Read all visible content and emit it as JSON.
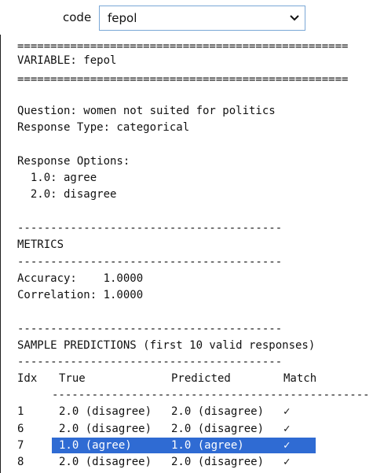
{
  "selector": {
    "label": "code",
    "value": "fepol"
  },
  "output": {
    "eq1": "==================================================",
    "variable": "VARIABLE: fepol",
    "eq2": "==================================================",
    "question": "Question: women not suited for politics",
    "response_type": "Response Type: categorical",
    "response_options_header": "Response Options:",
    "options": [
      "  1.0: agree",
      "  2.0: disagree"
    ],
    "dash1": "----------------------------------------",
    "metrics_header": "METRICS",
    "dash2": "----------------------------------------",
    "accuracy": "Accuracy:    1.0000",
    "correlation": "Correlation: 1.0000",
    "dash3": "----------------------------------------",
    "sample_header": "SAMPLE PREDICTIONS (first 10 valid responses)",
    "dash4": "----------------------------------------",
    "table": {
      "headers": [
        "Idx",
        "True",
        "Predicted",
        "Match"
      ],
      "rule": "------------------------------------------------",
      "rows": [
        {
          "idx": "1",
          "true": "2.0 (disagree)",
          "pred": "2.0 (disagree)",
          "match": "✓"
        },
        {
          "idx": "6",
          "true": "2.0 (disagree)",
          "pred": "2.0 (disagree)",
          "match": "✓"
        },
        {
          "idx": "7",
          "true": "1.0 (agree)",
          "pred": "1.0 (agree)",
          "match": "✓"
        },
        {
          "idx": "8",
          "true": "2.0 (disagree)",
          "pred": "2.0 (disagree)",
          "match": "✓"
        }
      ]
    }
  },
  "colors": {
    "select_border": "#7aa7d6",
    "selection": "#2f6bd3"
  }
}
